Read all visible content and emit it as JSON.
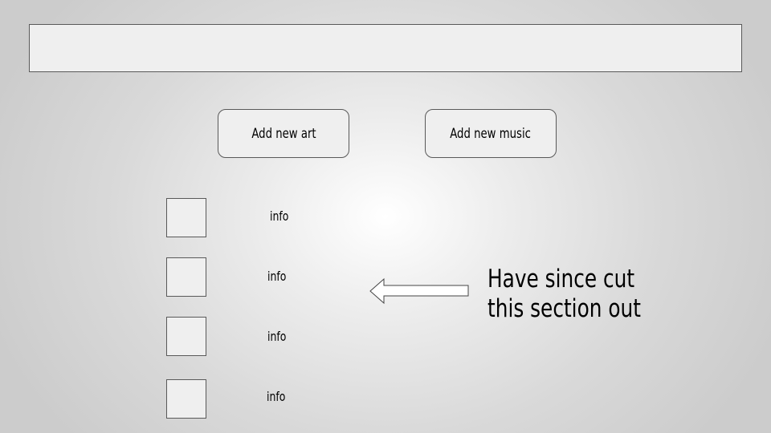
{
  "buttons": {
    "add_art": "Add new art",
    "add_music": "Add new music"
  },
  "list": {
    "items": [
      {
        "label": "info"
      },
      {
        "label": "info"
      },
      {
        "label": "info"
      },
      {
        "label": "info"
      }
    ]
  },
  "annotation": {
    "line1": "Have since cut",
    "line2": "this section out",
    "arrow_icon": "left-arrow-icon"
  },
  "colors": {
    "box_fill": "#efefef",
    "border": "#595959"
  }
}
